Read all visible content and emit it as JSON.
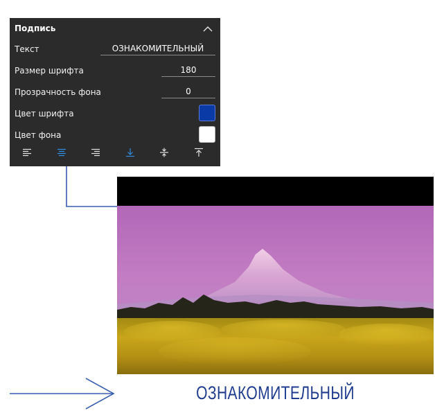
{
  "panel": {
    "title": "Подпись",
    "collapse_icon": "chevron-up-icon",
    "fields": {
      "text": {
        "label": "Текст",
        "value": "ОЗНАКОМИТЕЛЬНЫЙ"
      },
      "font_size": {
        "label": "Размер шрифта",
        "value": "180"
      },
      "bg_opacity": {
        "label": "Прозрачность фона",
        "value": "0"
      },
      "font_color": {
        "label": "Цвет шрифта",
        "color": "#0a3aa6"
      },
      "bg_color": {
        "label": "Цвет фона",
        "color": "#ffffff"
      }
    },
    "alignment_buttons": [
      {
        "icon": "align-left-icon",
        "active": false
      },
      {
        "icon": "align-center-icon",
        "active": true
      },
      {
        "icon": "align-right-icon",
        "active": false
      },
      {
        "icon": "align-bottom-icon",
        "active": true
      },
      {
        "icon": "align-middle-icon",
        "active": false
      },
      {
        "icon": "align-top-icon",
        "active": false
      }
    ],
    "colors": {
      "background": "#2b2b2b",
      "active_icon": "#2f8fe6",
      "inactive_icon": "#e6e6e6"
    }
  },
  "preview": {
    "caption": "ОЗНАКОМИТЕЛЬНЫЙ",
    "caption_color": "#1f3c8f",
    "caption_background": "#ffffff",
    "top_bar_color": "#000000"
  },
  "annotations": {
    "connector_color": "#3a5fb0"
  }
}
